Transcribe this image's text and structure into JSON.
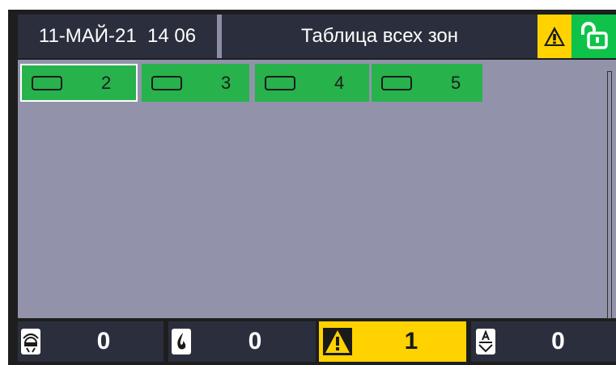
{
  "header": {
    "datetime": "11-МАЙ-21  14 06",
    "title": "Таблица всех зон",
    "icons": [
      "warning-icon",
      "unlock-icon"
    ]
  },
  "zones": [
    {
      "label": "2",
      "state": "normal",
      "selected": true
    },
    {
      "label": "3",
      "state": "normal",
      "selected": false
    },
    {
      "label": "4",
      "state": "normal",
      "selected": false
    },
    {
      "label": "5",
      "state": "normal",
      "selected": false
    }
  ],
  "footer": {
    "counters": [
      {
        "icon": "fire-alarm-icon",
        "value": "0"
      },
      {
        "icon": "flame-icon",
        "value": "0"
      },
      {
        "icon": "warning-icon",
        "value": "1"
      },
      {
        "icon": "disabled-icon",
        "value": "0"
      }
    ]
  },
  "colors": {
    "zone_normal": "#27b24c",
    "warning": "#ffd200",
    "unlock": "#0fc34a",
    "background": "#9293ab"
  }
}
